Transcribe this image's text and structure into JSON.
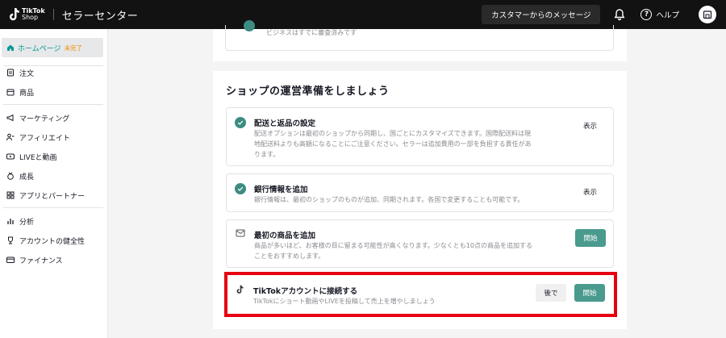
{
  "topbar": {
    "logo_line1": "TikTok",
    "logo_line2": "Shop",
    "app_title": "セラーセンター",
    "messages_button": "カスタマーからのメッセージ",
    "help_label": "ヘルプ",
    "help_glyph": "?"
  },
  "sidebar": {
    "home": {
      "label": "ホームページ",
      "badge": "未完了"
    },
    "items": [
      {
        "label": "注文",
        "icon": "order-icon"
      },
      {
        "label": "商品",
        "icon": "product-icon"
      },
      {
        "label": "マーケティング",
        "icon": "megaphone-icon"
      },
      {
        "label": "アフィリエイト",
        "icon": "affiliate-icon"
      },
      {
        "label": "LIVEと動画",
        "icon": "live-icon"
      },
      {
        "label": "成長",
        "icon": "growth-icon"
      },
      {
        "label": "アプリとパートナー",
        "icon": "apps-icon"
      },
      {
        "label": "分析",
        "icon": "analytics-icon"
      },
      {
        "label": "アカウントの健全性",
        "icon": "trophy-icon"
      },
      {
        "label": "ファイナンス",
        "icon": "finance-icon"
      }
    ]
  },
  "top_card": {
    "text": "ビジネスはすでに審査済みです"
  },
  "main": {
    "section_title": "ショップの運営準備をしましょう",
    "tasks": [
      {
        "title": "配送と返品の設定",
        "desc_line1": "配送オプションは最初のショップから同期し、国ごとにカスタマイズできます。国際配送料は現",
        "desc_line2": "地配送料よりも高額になることにご注意ください。セラーは追加費用の一部を負担する責任があ",
        "desc_line3": "ります。",
        "action": "表示",
        "done": true
      },
      {
        "title": "銀行情報を追加",
        "desc_line1": "銀行情報は、最初のショップのものが追加、同期されます。各国で変更することも可能です。",
        "action": "表示",
        "done": true
      },
      {
        "title": "最初の商品を追加",
        "desc_line1": "商品が多いほど、お客様の目に留まる可能性が高くなります。少なくとも10点の商品を追加する",
        "desc_line2": "ことをおすすめします。",
        "action": "開始",
        "done": false
      },
      {
        "title": "TikTokアカウントに接続する",
        "desc_line1": "TikTokにショート動画やLIVEを投稿して売上を増やしましょう",
        "later": "後で",
        "action": "開始",
        "done": false
      }
    ]
  },
  "colors": {
    "accent": "#009995",
    "button": "#4a9a8e",
    "highlight": "#e60012",
    "badge": "#f08c00"
  }
}
